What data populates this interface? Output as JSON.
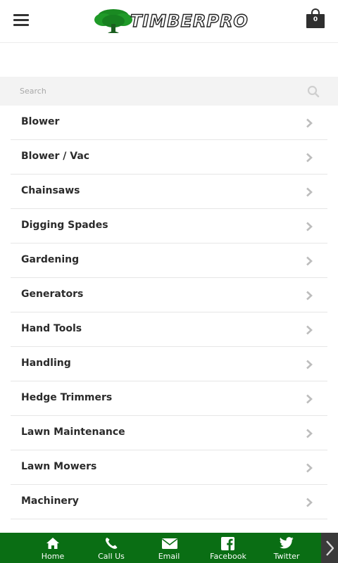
{
  "header": {
    "logo_text": "TIMBERPRO",
    "cart_count": "0"
  },
  "search": {
    "placeholder": "Search"
  },
  "categories": [
    "Blower",
    "Blower / Vac",
    "Chainsaws",
    "Digging Spades",
    "Gardening",
    "Generators",
    "Hand Tools",
    "Handling",
    "Hedge Trimmers",
    "Lawn Maintenance",
    "Lawn Mowers",
    "Machinery"
  ],
  "bottom_nav": [
    {
      "label": "Home",
      "icon": "home-icon"
    },
    {
      "label": "Call Us",
      "icon": "phone-icon"
    },
    {
      "label": "Email",
      "icon": "envelope-icon"
    },
    {
      "label": "Facebook",
      "icon": "facebook-icon"
    },
    {
      "label": "Twitter",
      "icon": "twitter-icon"
    }
  ],
  "colors": {
    "nav_background": "#0a6e14",
    "tree_green": "#1a8a22",
    "search_background": "#f3f3f3"
  }
}
